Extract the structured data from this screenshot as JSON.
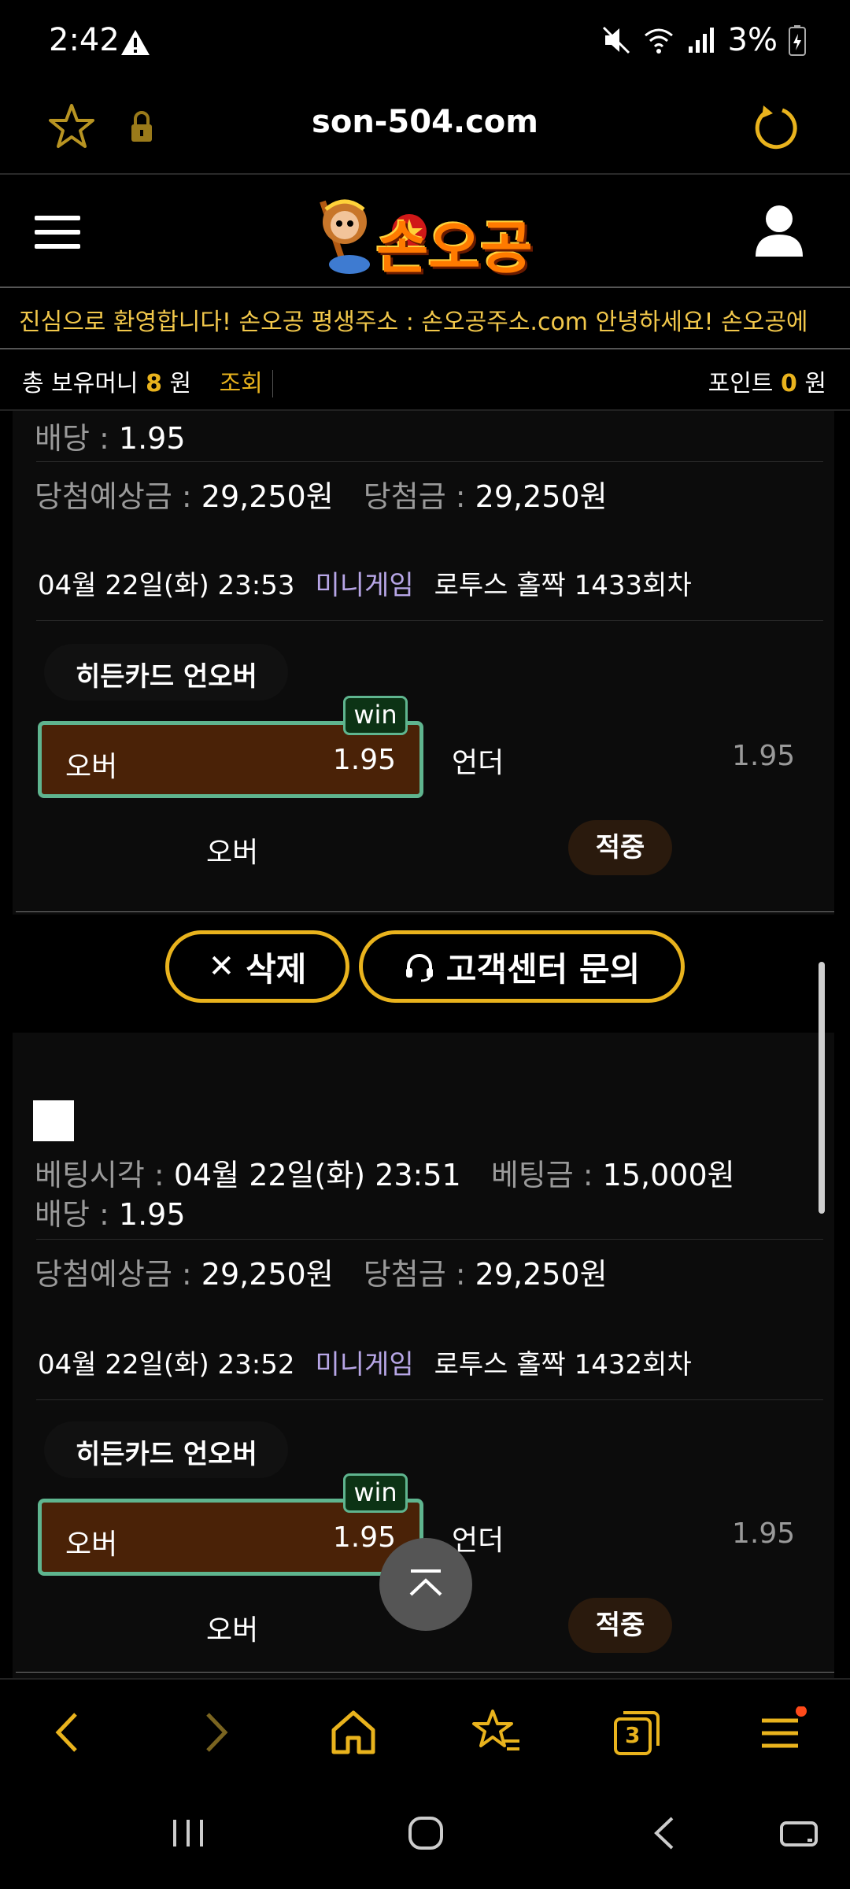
{
  "status_bar": {
    "time": "2:42",
    "battery": "3%"
  },
  "browser": {
    "url": "son-504.com",
    "tab_count": "3"
  },
  "site": {
    "logo_text": "손오공",
    "marquee": "진심으로 환영합니다! 손오공 평생주소 : 손오공주소.com    안녕하세요! 손오공에",
    "money_label": "총 보유머니",
    "money_value": "8",
    "money_unit": "원",
    "inquiry_label": "조회",
    "point_label": "포인트",
    "point_value": "0",
    "point_unit": "원"
  },
  "labels": {
    "odds": "배당 : ",
    "expected": "당첨예상금 : ",
    "winnings": "당첨금 : ",
    "bet_time": "베팅시각 : ",
    "bet_amount": "베팅금 : ",
    "delete_button": "삭제",
    "support_button": "고객센터 문의"
  },
  "bets": [
    {
      "odds": "1.95",
      "expected": "29,250원",
      "winnings": "29,250원",
      "game_datetime": "04월 22일(화) 23:53",
      "category": "미니게임",
      "game_name": "로투스 홀짝 1433회차",
      "market": "히든카드 언오버",
      "option_over": "오버",
      "odds_over": "1.95",
      "option_under": "언더",
      "odds_under": "1.95",
      "win_badge": "win",
      "pick": "오버",
      "result": "적중"
    },
    {
      "bet_time": "04월 22일(화) 23:51",
      "bet_amount": "15,000원",
      "odds": "1.95",
      "expected": "29,250원",
      "winnings": "29,250원",
      "game_datetime": "04월 22일(화) 23:52",
      "category": "미니게임",
      "game_name": "로투스 홀짝 1432회차",
      "market": "히든카드 언오버",
      "option_over": "오버",
      "odds_over": "1.95",
      "option_under": "언더",
      "odds_under": "1.95",
      "win_badge": "win",
      "pick": "오버",
      "result": "적중"
    }
  ],
  "icons": {
    "warning": "warning-icon",
    "mute": "mute-icon",
    "wifi": "wifi-icon",
    "signal": "signal-icon",
    "battery": "battery-icon",
    "bookmark": "star-icon",
    "lock": "lock-icon",
    "reload": "reload-icon",
    "menu": "hamburger-menu-icon",
    "user": "user-icon",
    "close": "close-icon",
    "headset": "headset-icon",
    "to_top": "chevron-up-icon",
    "back": "back-icon",
    "forward": "forward-icon",
    "home": "home-icon",
    "bookmarks": "bookmarks-icon",
    "tabs": "tabs-icon",
    "more": "more-menu-icon"
  },
  "colors": {
    "accent": "#e9b31d",
    "win_border": "#5fb58f",
    "selected_bg": "#4a2207",
    "category": "#b7a6e6"
  }
}
